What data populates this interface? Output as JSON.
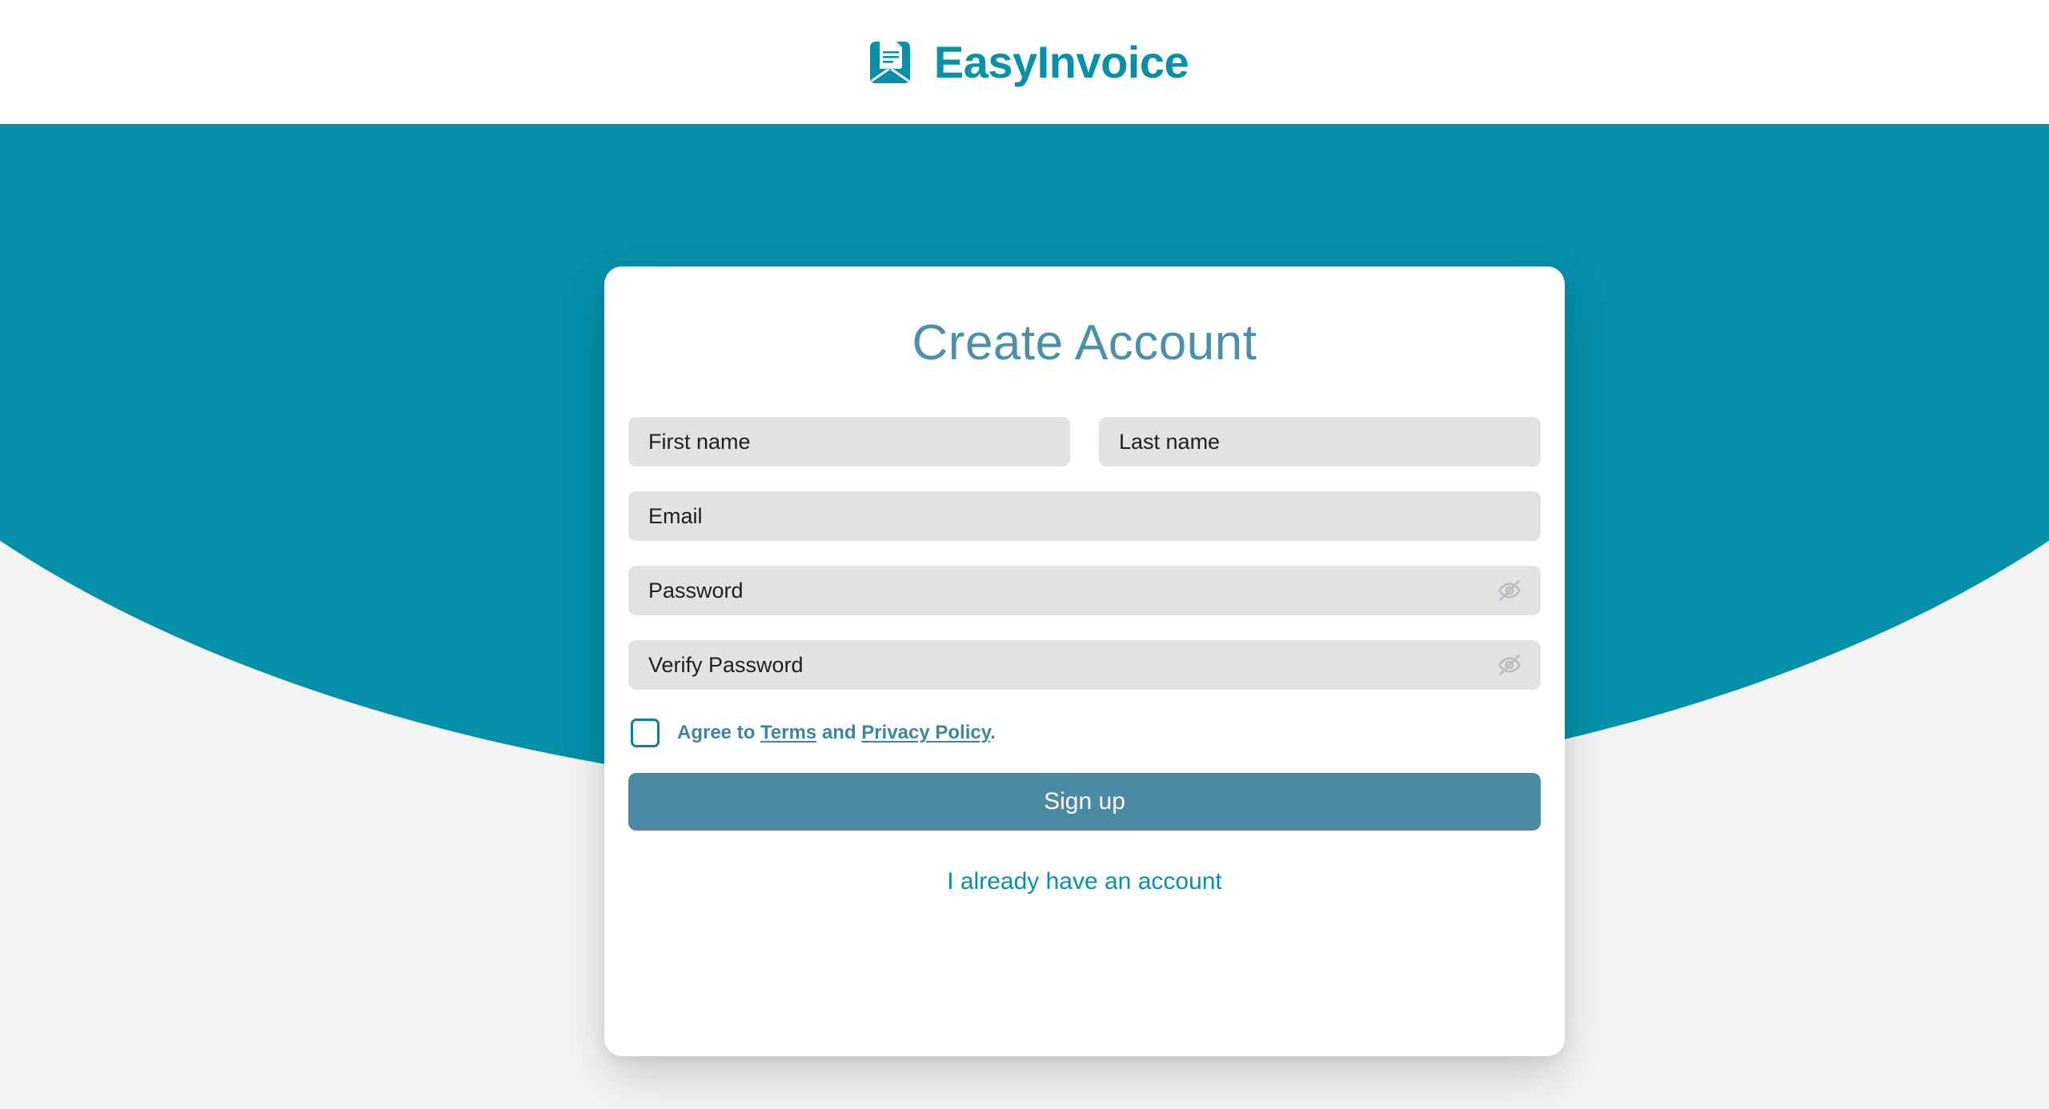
{
  "header": {
    "brand_name": "EasyInvoice",
    "logo_icon": "envelope-document-icon"
  },
  "card": {
    "title": "Create Account",
    "fields": {
      "first_name": {
        "placeholder": "First name",
        "value": ""
      },
      "last_name": {
        "placeholder": "Last name",
        "value": ""
      },
      "email": {
        "placeholder": "Email",
        "value": ""
      },
      "password": {
        "placeholder": "Password",
        "value": "",
        "toggle_icon": "eye-off-icon"
      },
      "verify_password": {
        "placeholder": "Verify Password",
        "value": "",
        "toggle_icon": "eye-off-icon"
      }
    },
    "terms": {
      "checked": false,
      "prefix": "Agree to ",
      "terms_link": "Terms",
      "middle": " and ",
      "privacy_link": "Privacy Policy",
      "suffix": "."
    },
    "actions": {
      "signup_label": "Sign up",
      "existing_account_label": "I already have an account"
    }
  },
  "colors": {
    "brand_teal": "#0590aa",
    "logo_teal": "#0890a8",
    "title_blue": "#4b90a8",
    "primary_button": "#4a8ba3",
    "link_teal": "#3f85a0",
    "checkbox_border": "#0e8099",
    "field_grey": "#e2e2e2",
    "page_grey": "#f4f4f4",
    "card_white": "#ffffff"
  }
}
